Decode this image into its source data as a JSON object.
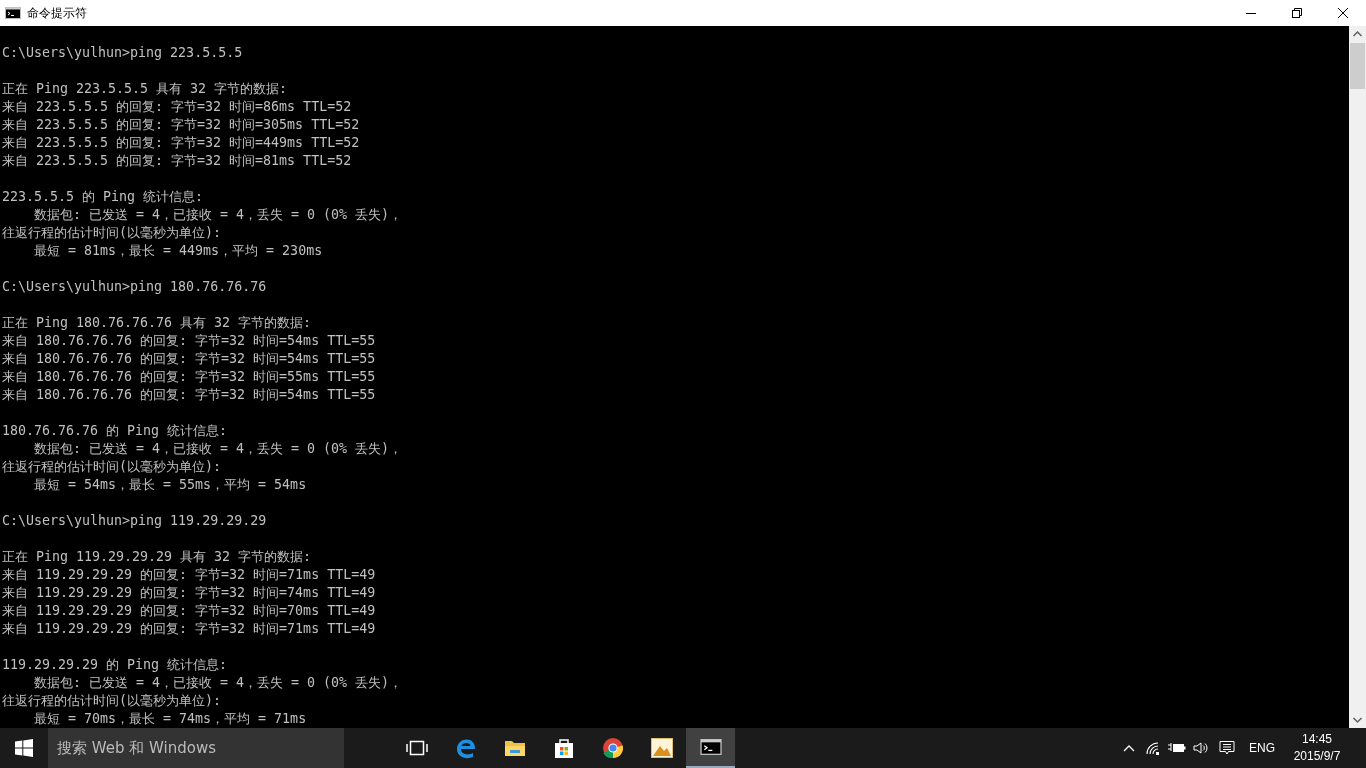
{
  "window": {
    "title": "命令提示符"
  },
  "console": {
    "blocks": [
      [
        "C:\\Users\\yulhun>ping 223.5.5.5"
      ],
      [
        "正在 Ping 223.5.5.5 具有 32 字节的数据:",
        "来自 223.5.5.5 的回复: 字节=32 时间=86ms TTL=52",
        "来自 223.5.5.5 的回复: 字节=32 时间=305ms TTL=52",
        "来自 223.5.5.5 的回复: 字节=32 时间=449ms TTL=52",
        "来自 223.5.5.5 的回复: 字节=32 时间=81ms TTL=52"
      ],
      [
        "223.5.5.5 的 Ping 统计信息:",
        "    数据包: 已发送 = 4，已接收 = 4，丢失 = 0 (0% 丢失)，",
        "往返行程的估计时间(以毫秒为单位):",
        "    最短 = 81ms，最长 = 449ms，平均 = 230ms"
      ],
      [
        "C:\\Users\\yulhun>ping 180.76.76.76"
      ],
      [
        "正在 Ping 180.76.76.76 具有 32 字节的数据:",
        "来自 180.76.76.76 的回复: 字节=32 时间=54ms TTL=55",
        "来自 180.76.76.76 的回复: 字节=32 时间=54ms TTL=55",
        "来自 180.76.76.76 的回复: 字节=32 时间=55ms TTL=55",
        "来自 180.76.76.76 的回复: 字节=32 时间=54ms TTL=55"
      ],
      [
        "180.76.76.76 的 Ping 统计信息:",
        "    数据包: 已发送 = 4，已接收 = 4，丢失 = 0 (0% 丢失)，",
        "往返行程的估计时间(以毫秒为单位):",
        "    最短 = 54ms，最长 = 55ms，平均 = 54ms"
      ],
      [
        "C:\\Users\\yulhun>ping 119.29.29.29"
      ],
      [
        "正在 Ping 119.29.29.29 具有 32 字节的数据:",
        "来自 119.29.29.29 的回复: 字节=32 时间=71ms TTL=49",
        "来自 119.29.29.29 的回复: 字节=32 时间=74ms TTL=49",
        "来自 119.29.29.29 的回复: 字节=32 时间=70ms TTL=49",
        "来自 119.29.29.29 的回复: 字节=32 时间=71ms TTL=49"
      ],
      [
        "119.29.29.29 的 Ping 统计信息:",
        "    数据包: 已发送 = 4，已接收 = 4，丢失 = 0 (0% 丢失)，",
        "往返行程的估计时间(以毫秒为单位):",
        "    最短 = 70ms，最长 = 74ms，平均 = 71ms"
      ]
    ]
  },
  "taskbar": {
    "search": {
      "placeholder": "搜索 Web 和 Windows"
    },
    "apps": [
      {
        "kind": "taskview",
        "active": false
      },
      {
        "kind": "edge",
        "active": false
      },
      {
        "kind": "folder",
        "active": false
      },
      {
        "kind": "store",
        "active": false
      },
      {
        "kind": "chrome",
        "active": false
      },
      {
        "kind": "photos",
        "active": false
      },
      {
        "kind": "cmd",
        "active": true
      }
    ],
    "language": "ENG",
    "time": "14:45",
    "date": "2015/9/7"
  }
}
